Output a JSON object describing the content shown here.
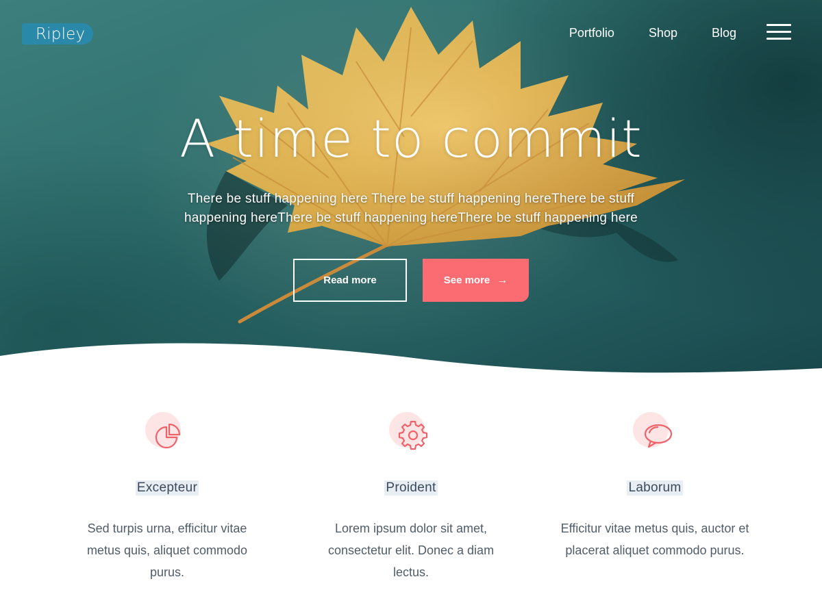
{
  "brand": {
    "logo_text": "Ripley"
  },
  "nav": {
    "links": [
      {
        "label": "Portfolio"
      },
      {
        "label": "Shop"
      },
      {
        "label": "Blog"
      }
    ],
    "menu_icon": "hamburger-menu-icon"
  },
  "hero": {
    "title": "A time to commit",
    "subtitle": "There be stuff happening here There be stuff happening hereThere be stuff happening hereThere be stuff happening hereThere be stuff happening here",
    "primary_button": "Read more",
    "secondary_button": "See more",
    "secondary_button_icon": "arrow-right-icon",
    "accent_color": "#fb6c72",
    "background_image": "yellow maple leaf floating on teal water"
  },
  "features": [
    {
      "icon": "pie-chart-icon",
      "title": "Excepteur",
      "text": "Sed turpis urna, efficitur vitae metus quis, aliquet commodo purus."
    },
    {
      "icon": "gear-icon",
      "title": "Proident",
      "text": "Lorem ipsum dolor sit amet, consectetur elit. Donec a diam lectus."
    },
    {
      "icon": "speech-bubble-icon",
      "title": "Laborum",
      "text": "Efficitur vitae metus quis, auctor et placerat aliquet commodo purus."
    }
  ],
  "colors": {
    "accent": "#fb6c72",
    "icon_bg": "#fde5e6",
    "logo_bg": "#2a88a8",
    "text": "#3a4a5a"
  }
}
